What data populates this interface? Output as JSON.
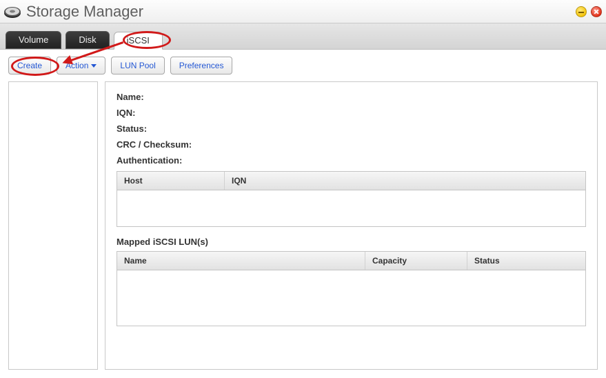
{
  "window": {
    "title": "Storage Manager"
  },
  "tabs": {
    "volume": "Volume",
    "disk": "Disk",
    "iscsi": "iSCSI"
  },
  "toolbar": {
    "create": "Create",
    "action": "Action",
    "lunpool": "LUN Pool",
    "preferences": "Preferences"
  },
  "details": {
    "labels": {
      "name": "Name",
      "iqn": "IQN",
      "status": "Status",
      "crc": "CRC / Checksum",
      "auth": "Authentication"
    },
    "host_grid": {
      "headers": {
        "host": "Host",
        "iqn": "IQN"
      }
    },
    "mapped_title": "Mapped iSCSI LUN(s)",
    "lun_grid": {
      "headers": {
        "name": "Name",
        "capacity": "Capacity",
        "status": "Status"
      }
    }
  }
}
